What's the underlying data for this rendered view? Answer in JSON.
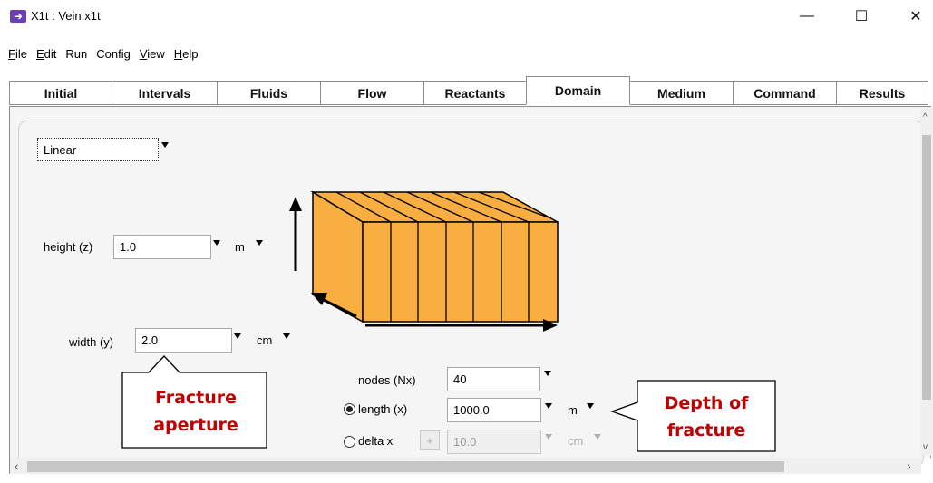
{
  "window": {
    "title": "X1t : Vein.x1t",
    "minimize": "—",
    "maximize": "☐",
    "close": "✕"
  },
  "menu": [
    {
      "label": "File",
      "accel": "F",
      "rest": "ile"
    },
    {
      "label": "Edit",
      "accel": "E",
      "rest": "dit"
    },
    {
      "label": "Run",
      "accel": "",
      "rest": "Run"
    },
    {
      "label": "Config",
      "accel": "",
      "rest": "Config"
    },
    {
      "label": "View",
      "accel": "V",
      "rest": "iew"
    },
    {
      "label": "Help",
      "accel": "H",
      "rest": "elp"
    }
  ],
  "tabs": [
    "Initial",
    "Intervals",
    "Fluids",
    "Flow",
    "Reactants",
    "Domain",
    "Medium",
    "Command",
    "Results"
  ],
  "active_tab": "Domain",
  "domain": {
    "geometry": "Linear",
    "height_label": "height (z)",
    "height_value": "1.0",
    "height_unit": "m",
    "width_label": "width (y)",
    "width_value": "2.0",
    "width_unit": "cm",
    "nodes_label": "nodes (Nx)",
    "nodes_value": "40",
    "length_label": "length (x)",
    "length_value": "1000.0",
    "length_unit": "m",
    "delta_label": "delta x",
    "delta_plus": "+",
    "delta_value": "10.0",
    "delta_unit": "cm"
  },
  "callouts": {
    "aperture": [
      "Fracture",
      "aperture"
    ],
    "depth": [
      "Depth of",
      "fracture"
    ]
  },
  "colors": {
    "block_fill": "#f9ae42",
    "callout_text": "#c00000",
    "icon": "#6b3fb8"
  },
  "icons": {
    "app": "arrow-right-icon",
    "scroll_up": "chevron-up-icon",
    "scroll_down": "chevron-down-icon",
    "scroll_left": "chevron-left-icon",
    "scroll_right": "chevron-right-icon"
  }
}
